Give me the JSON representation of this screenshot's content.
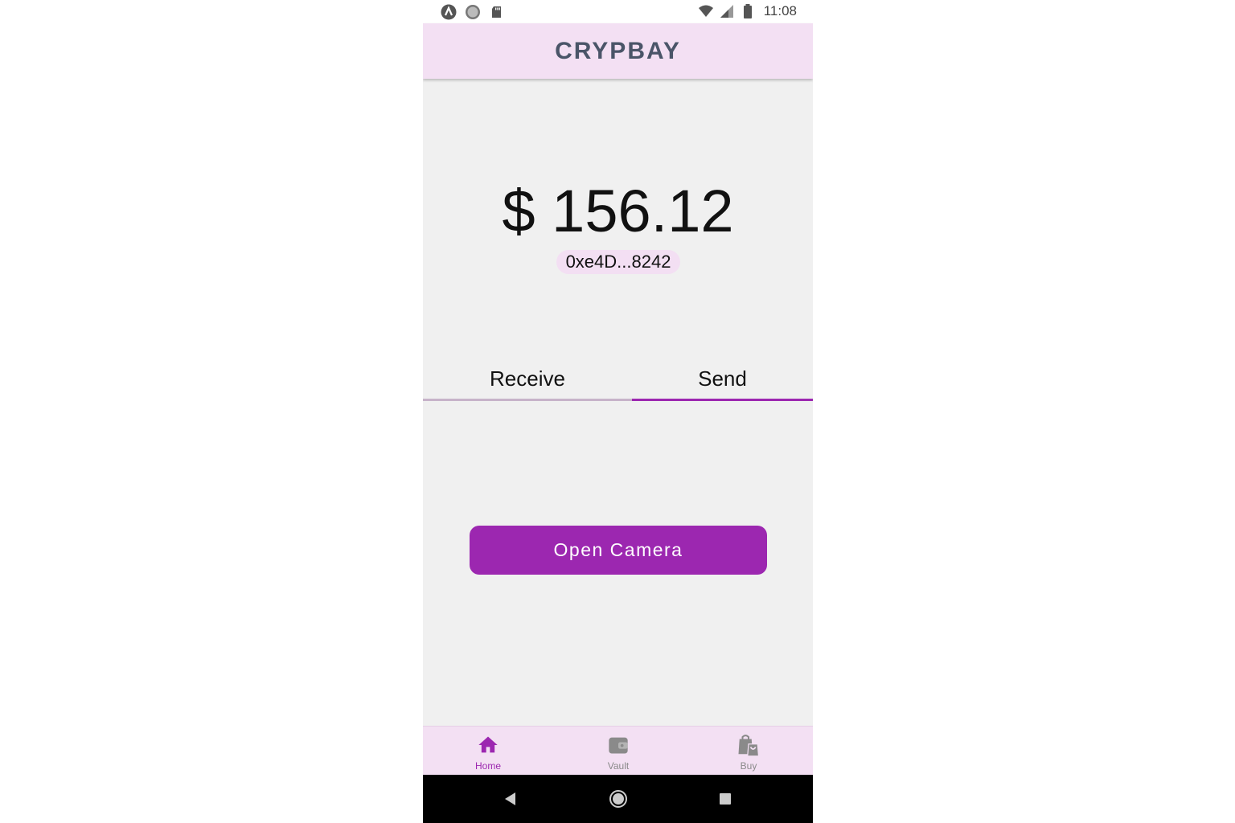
{
  "status_bar": {
    "time": "11:08",
    "left_icons": [
      "a-logo-icon",
      "circle-dot-icon",
      "sd-card-icon"
    ],
    "right_icons": [
      "wifi-icon",
      "signal-icon",
      "battery-icon"
    ]
  },
  "app_bar": {
    "title": "CRYPBAY"
  },
  "wallet": {
    "balance": "$ 156.12",
    "address": "0xe4D...8242"
  },
  "tabs": [
    {
      "label": "Receive",
      "selected": false
    },
    {
      "label": "Send",
      "selected": true
    }
  ],
  "send": {
    "button_label": "Open Camera"
  },
  "bottom_nav": {
    "items": [
      {
        "label": "Home",
        "icon": "home-icon",
        "active": true
      },
      {
        "label": "Vault",
        "icon": "wallet-icon",
        "active": false
      },
      {
        "label": "Buy",
        "icon": "shopping-bag-icon",
        "active": false
      }
    ]
  },
  "colors": {
    "accent": "#9c27b0",
    "app_bar_bg": "#f3e0f3",
    "title_color": "#4a5568",
    "inactive_icon": "#8a8a8a"
  }
}
